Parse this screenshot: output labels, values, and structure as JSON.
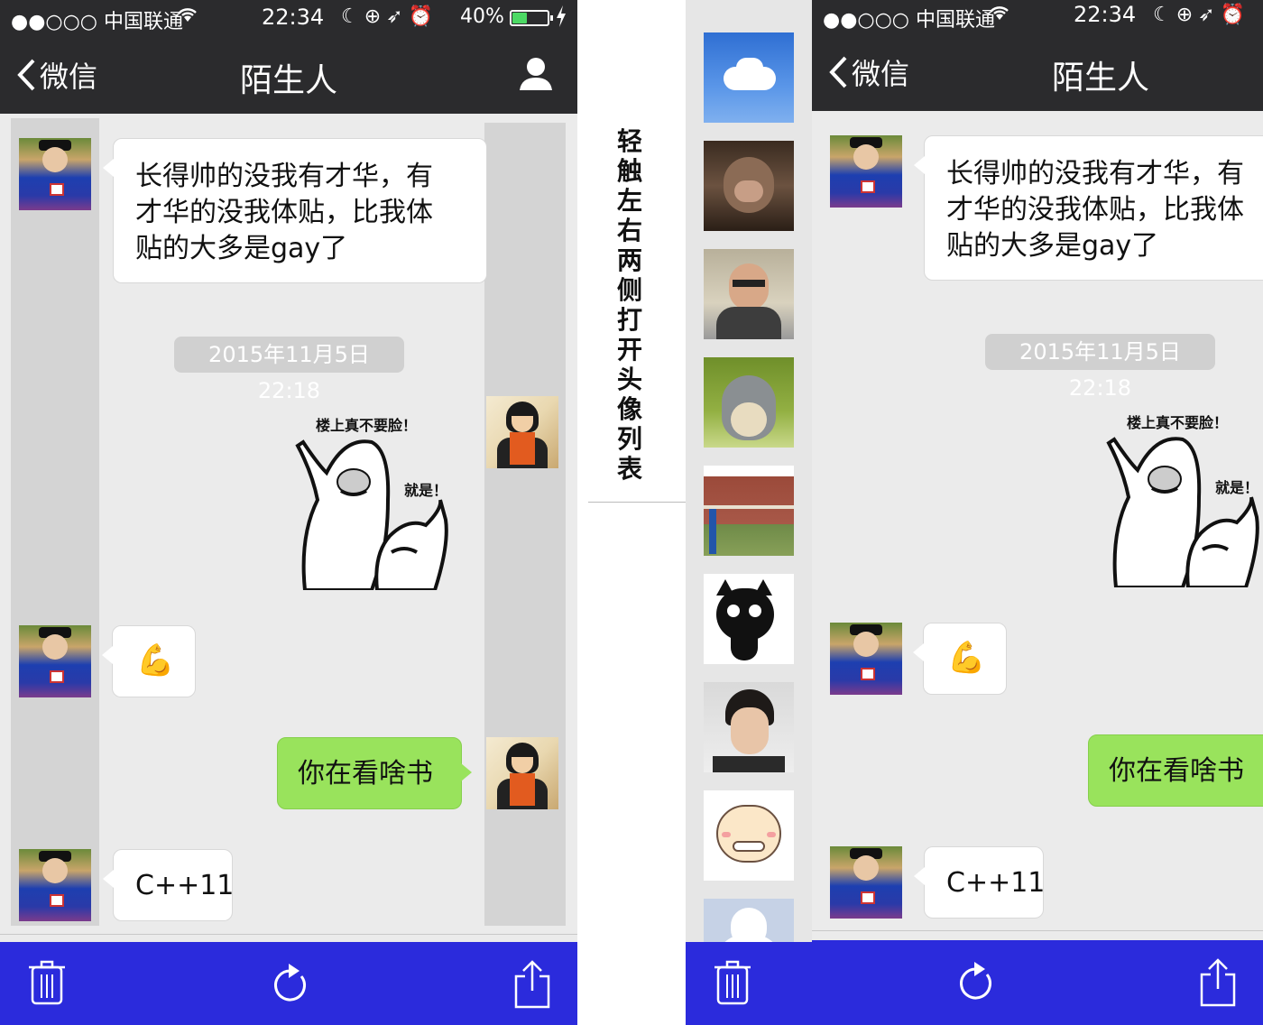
{
  "status_bar": {
    "carrier": "●●○○○ 中国联通",
    "time": "22:34",
    "battery": "40%",
    "battery_level": 0.4
  },
  "nav": {
    "back_label": "微信",
    "title": "陌生人"
  },
  "messages": {
    "m1": {
      "lines": [
        "长得帅的没我有才华，有",
        "才华的没我体贴，比我体",
        "贴的大多是gay了"
      ]
    },
    "timestamp": "2015年11月5日 22:18",
    "sticker": {
      "caption1": "楼上真不要脸！",
      "caption2": "就是！"
    },
    "m3": "💪",
    "m4": "你在看啥书",
    "m5": "C++11"
  },
  "hint": "轻触左右两侧打开头像列表",
  "colors": {
    "nav_bg": "#2b2b2d",
    "chat_bg": "#ebebeb",
    "toolbar_bg": "#2b2bdc",
    "bubble_green": "#99e35c",
    "overlay_gray": "#d4d4d4"
  },
  "icons": {
    "toolbar": [
      "trash-icon",
      "refresh-icon",
      "share-icon"
    ]
  }
}
